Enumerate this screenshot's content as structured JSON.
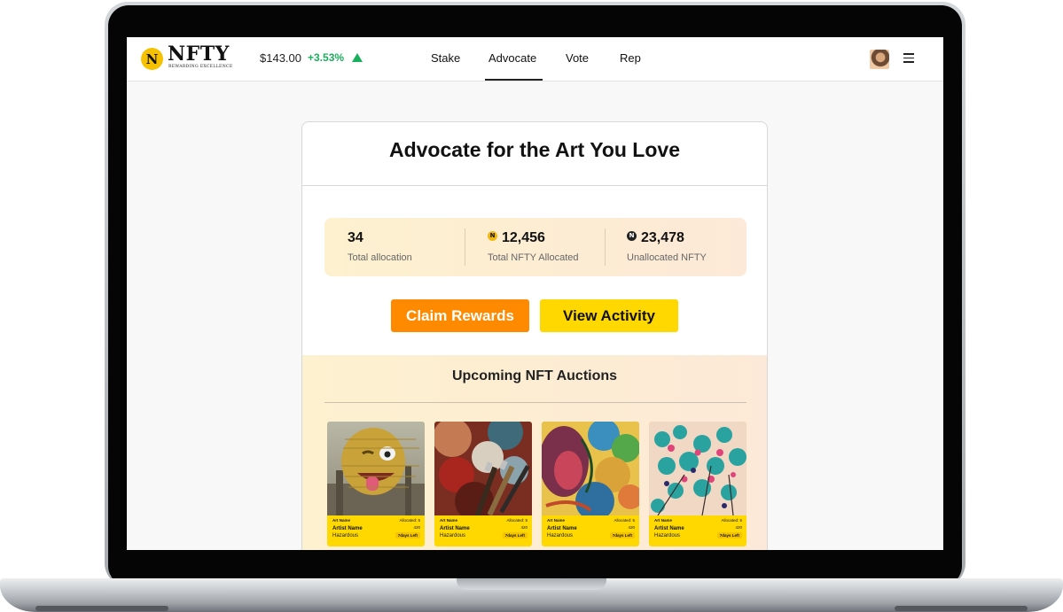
{
  "brand": {
    "name": "NFTY",
    "tagline": "REWARDING EXCELLENCE",
    "coin_letter": "N"
  },
  "ticker": {
    "price": "$143.00",
    "change": "+3.53%",
    "color_up": "#1aaf5d"
  },
  "nav": {
    "links": [
      "Stake",
      "Advocate",
      "Vote",
      "Rep"
    ],
    "active": "Advocate"
  },
  "card": {
    "title": "Advocate for the Art You Love",
    "stats": [
      {
        "value": "34",
        "label": "Total allocation",
        "icon": ""
      },
      {
        "value": "12,456",
        "label": "Total NFTY Allocated",
        "icon": "nfty-gold-coin-icon"
      },
      {
        "value": "23,478",
        "label": "Unallocated NFTY",
        "icon": "nfty-dark-coin-icon"
      }
    ],
    "buttons": {
      "claim": "Claim Rewards",
      "view": "View Activity"
    },
    "colors": {
      "claim": "#ff8a00",
      "view": "#ffd800"
    }
  },
  "auctions": {
    "title": "Upcoming NFT Auctions",
    "items": [
      {
        "art_label": "Art Name",
        "allocated": "Allocated: 5",
        "artist": "Artist Name",
        "price": "420",
        "genre": "Hazardous",
        "days": "7days Left"
      },
      {
        "art_label": "Art Name",
        "allocated": "Allocated: 5",
        "artist": "Artist Name",
        "price": "420",
        "genre": "Hazardous",
        "days": "7days Left"
      },
      {
        "art_label": "Art Name",
        "allocated": "Allocated: 5",
        "artist": "Artist Name",
        "price": "420",
        "genre": "Hazardous",
        "days": "7days Left"
      },
      {
        "art_label": "Art Name",
        "allocated": "Allocated: 5",
        "artist": "Artist Name",
        "price": "420",
        "genre": "Hazardous",
        "days": "7days Left"
      }
    ]
  }
}
